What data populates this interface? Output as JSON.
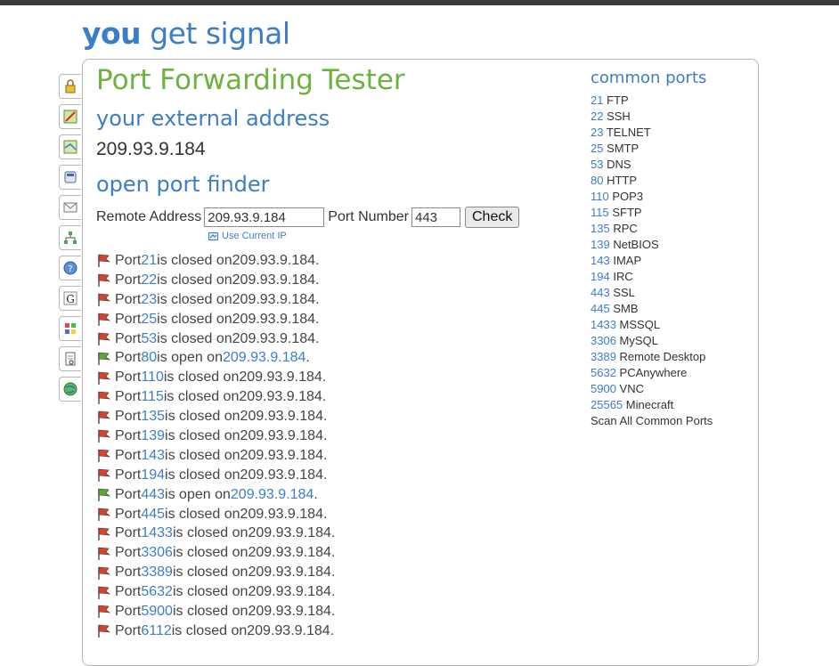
{
  "logo": {
    "part1": "you",
    "part2": "get sig",
    "part3": "nal"
  },
  "page": {
    "title": "Port Forwarding Tester",
    "external_heading": "your external address",
    "external_ip": "209.93.9.184",
    "finder_heading": "open port finder"
  },
  "form": {
    "remote_label": "Remote Address",
    "remote_value": "209.93.9.184",
    "port_label": "Port Number",
    "port_value": "443",
    "check_label": "Check",
    "use_current_label": "Use Current IP"
  },
  "sidebar_icons": [
    "lock-icon",
    "map-edit-icon",
    "map-icon",
    "phone-icon",
    "mail-icon",
    "network-icon",
    "help-icon",
    "google-icon",
    "windows-icon",
    "document-link-icon",
    "globe-icon"
  ],
  "results": [
    {
      "port": "21",
      "status": "closed",
      "ip": "209.93.9.184"
    },
    {
      "port": "22",
      "status": "closed",
      "ip": "209.93.9.184"
    },
    {
      "port": "23",
      "status": "closed",
      "ip": "209.93.9.184"
    },
    {
      "port": "25",
      "status": "closed",
      "ip": "209.93.9.184"
    },
    {
      "port": "53",
      "status": "closed",
      "ip": "209.93.9.184"
    },
    {
      "port": "80",
      "status": "open",
      "ip": "209.93.9.184"
    },
    {
      "port": "110",
      "status": "closed",
      "ip": "209.93.9.184"
    },
    {
      "port": "115",
      "status": "closed",
      "ip": "209.93.9.184"
    },
    {
      "port": "135",
      "status": "closed",
      "ip": "209.93.9.184"
    },
    {
      "port": "139",
      "status": "closed",
      "ip": "209.93.9.184"
    },
    {
      "port": "143",
      "status": "closed",
      "ip": "209.93.9.184"
    },
    {
      "port": "194",
      "status": "closed",
      "ip": "209.93.9.184"
    },
    {
      "port": "443",
      "status": "open",
      "ip": "209.93.9.184"
    },
    {
      "port": "445",
      "status": "closed",
      "ip": "209.93.9.184"
    },
    {
      "port": "1433",
      "status": "closed",
      "ip": "209.93.9.184"
    },
    {
      "port": "3306",
      "status": "closed",
      "ip": "209.93.9.184"
    },
    {
      "port": "3389",
      "status": "closed",
      "ip": "209.93.9.184"
    },
    {
      "port": "5632",
      "status": "closed",
      "ip": "209.93.9.184"
    },
    {
      "port": "5900",
      "status": "closed",
      "ip": "209.93.9.184"
    },
    {
      "port": "6112",
      "status": "closed",
      "ip": "209.93.9.184"
    }
  ],
  "result_text": {
    "prefix": "Port",
    "is_closed": "is closed on",
    "is_open": "is open on",
    "suffix": "."
  },
  "common_ports": {
    "title": "common ports",
    "items": [
      {
        "num": "21",
        "name": "FTP"
      },
      {
        "num": "22",
        "name": "SSH"
      },
      {
        "num": "23",
        "name": "TELNET"
      },
      {
        "num": "25",
        "name": "SMTP"
      },
      {
        "num": "53",
        "name": "DNS"
      },
      {
        "num": "80",
        "name": "HTTP"
      },
      {
        "num": "110",
        "name": "POP3"
      },
      {
        "num": "115",
        "name": "SFTP"
      },
      {
        "num": "135",
        "name": "RPC"
      },
      {
        "num": "139",
        "name": "NetBIOS"
      },
      {
        "num": "143",
        "name": "IMAP"
      },
      {
        "num": "194",
        "name": "IRC"
      },
      {
        "num": "443",
        "name": "SSL"
      },
      {
        "num": "445",
        "name": "SMB"
      },
      {
        "num": "1433",
        "name": "MSSQL"
      },
      {
        "num": "3306",
        "name": "MySQL"
      },
      {
        "num": "3389",
        "name": "Remote Desktop"
      },
      {
        "num": "5632",
        "name": "PCAnywhere"
      },
      {
        "num": "5900",
        "name": "VNC"
      },
      {
        "num": "25565",
        "name": "Minecraft"
      }
    ],
    "scan_all": "Scan All Common Ports"
  },
  "colors": {
    "brand_blue": "#3d7dc8",
    "brand_green": "#6cb33e",
    "closed_flag": "#d9412b",
    "open_flag": "#5aa832"
  }
}
